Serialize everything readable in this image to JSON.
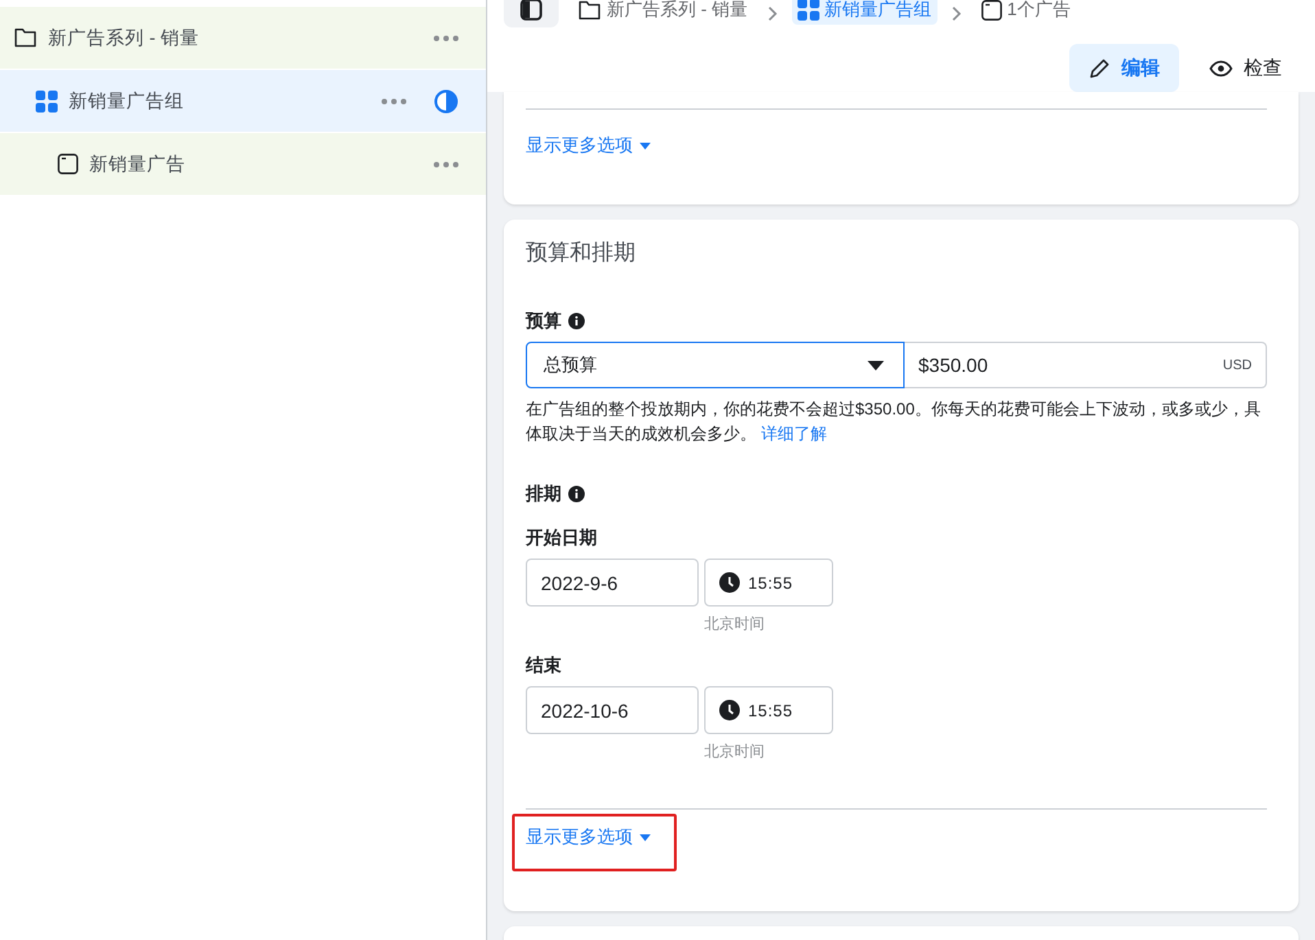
{
  "tree": [
    {
      "kind": "campaign",
      "label": "新广告系列 - 销量",
      "selected": false,
      "has_status": false,
      "children": [
        {
          "kind": "adset",
          "label": "新销量广告组",
          "selected": true,
          "has_status": true,
          "children": [
            {
              "kind": "ad",
              "label": "新销量广告",
              "selected": false,
              "has_status": false
            }
          ]
        }
      ]
    }
  ],
  "breadcrumb": [
    {
      "kind": "campaign",
      "label": "新广告系列 - 销量",
      "selected": false
    },
    {
      "kind": "adset",
      "label": "新销量广告组",
      "selected": true
    },
    {
      "kind": "ad",
      "label": "1个广告",
      "selected": false
    }
  ],
  "actions": [
    {
      "kind": "edit",
      "label": "编辑",
      "selected": true
    },
    {
      "kind": "review",
      "label": "检查",
      "selected": false
    }
  ],
  "top_card": {
    "more_link": "显示更多选项"
  },
  "budget_card": {
    "title": "预算和排期",
    "budget_label": "预算",
    "budget_type": "总预算",
    "amount": "$350.00",
    "currency": "USD",
    "help": "在广告组的整个投放期内，你的花费不会超过$350.00。你每天的花费可能会上下波动，或多或少，具体取决于当天的成效机会多少。",
    "help_link": "详细了解",
    "schedule_label": "排期",
    "dates": [
      {
        "label": "开始日期",
        "date": "2022-9-6",
        "time": "15:55",
        "zone": "北京时间"
      },
      {
        "label": "结束",
        "date": "2022-10-6",
        "time": "15:55",
        "zone": "北京时间"
      }
    ],
    "more_link": "显示更多选项",
    "more_link_highlighted": true
  }
}
